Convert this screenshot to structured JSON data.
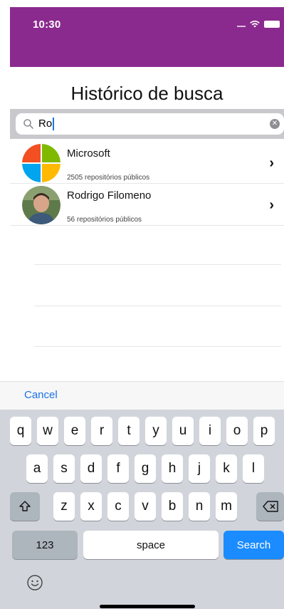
{
  "status_bar": {
    "time": "10:30"
  },
  "header": {
    "title": "Histórico de busca"
  },
  "search": {
    "value": "Ro",
    "clear_icon": "clear-icon"
  },
  "results": [
    {
      "name": "Microsoft",
      "subtitle": "2505 repositórios públicos",
      "avatar": "microsoft-logo"
    },
    {
      "name": "Rodrigo Filomeno",
      "subtitle": "56 repositórios públicos",
      "avatar": "user-photo"
    }
  ],
  "keyboard": {
    "cancel": "Cancel",
    "row1": [
      "q",
      "w",
      "e",
      "r",
      "t",
      "y",
      "u",
      "i",
      "o",
      "p"
    ],
    "row2": [
      "a",
      "s",
      "d",
      "f",
      "g",
      "h",
      "j",
      "k",
      "l"
    ],
    "row3": [
      "z",
      "x",
      "c",
      "v",
      "b",
      "n",
      "m"
    ],
    "numbers": "123",
    "space": "space",
    "search": "Search"
  },
  "colors": {
    "status_bar": "#8b2a8e",
    "accent": "#1a73e8",
    "search_key": "#1a8cff"
  }
}
